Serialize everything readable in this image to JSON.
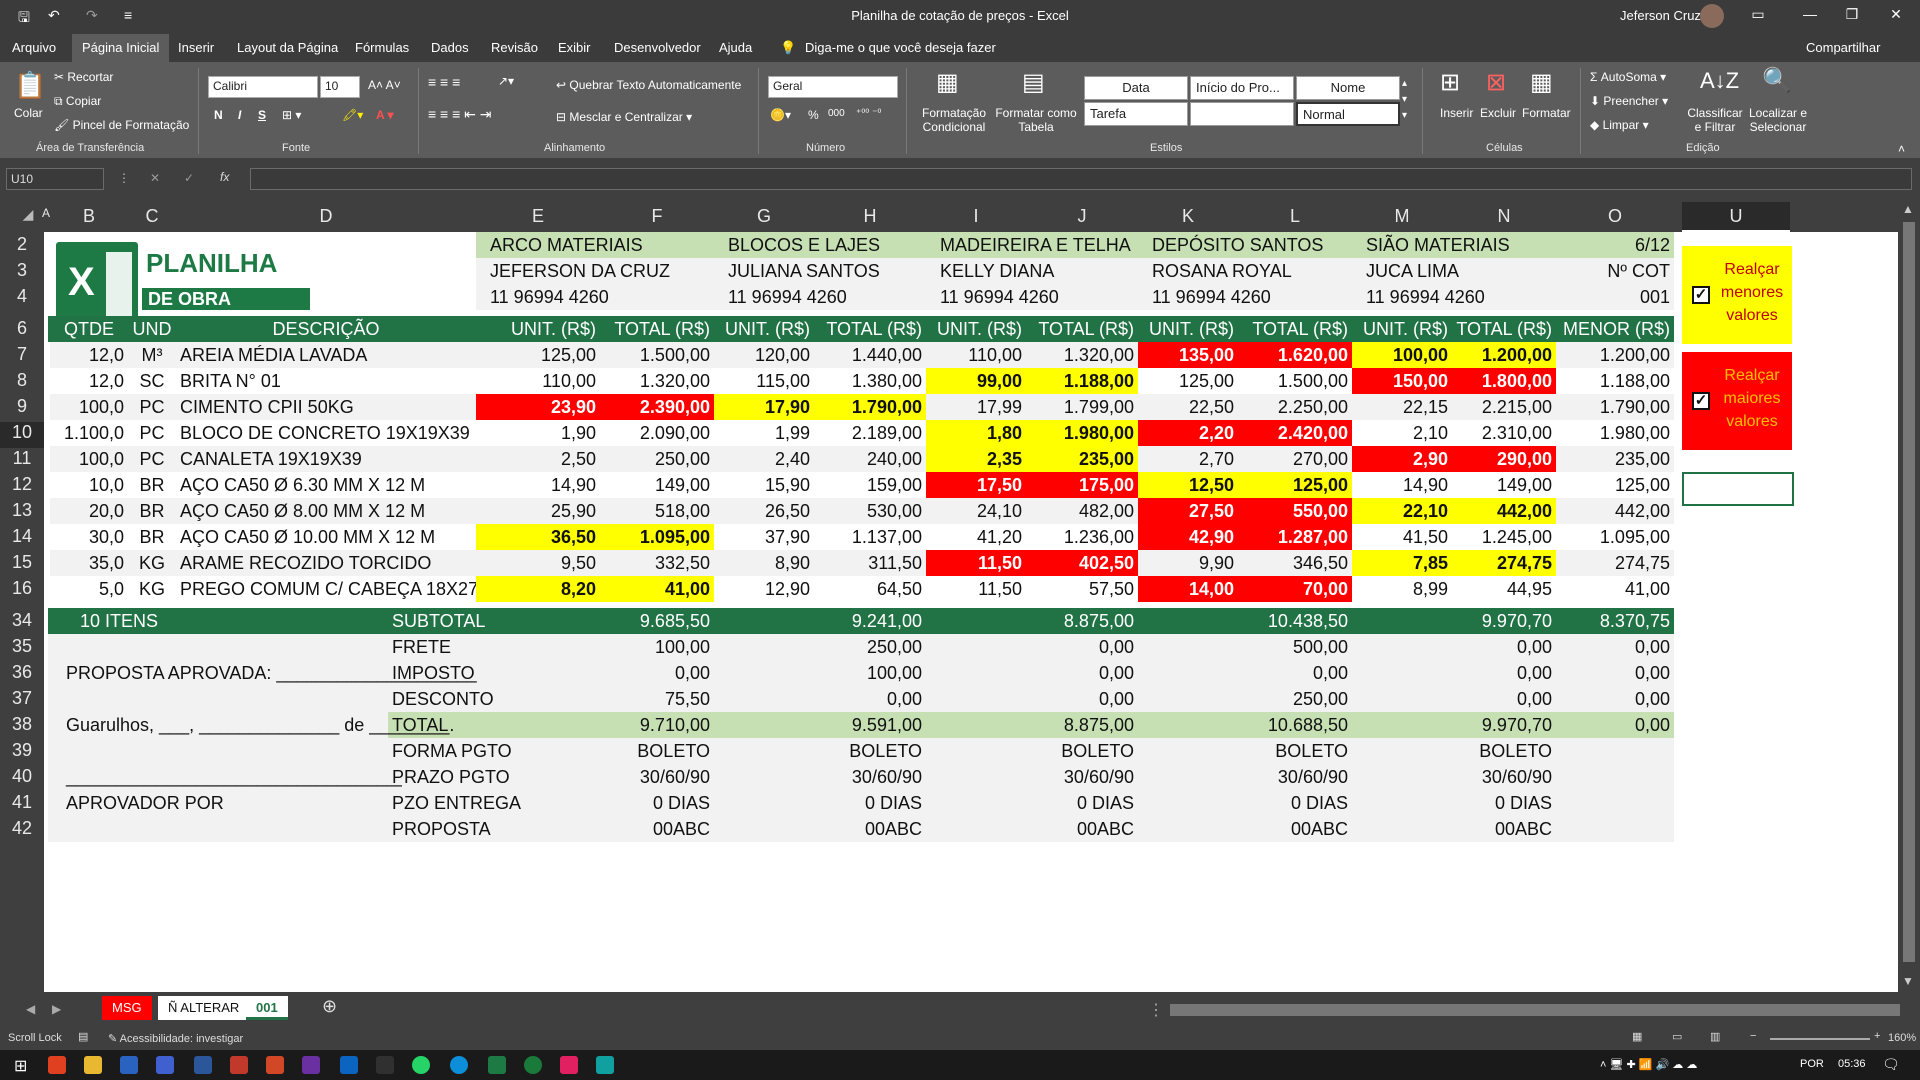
{
  "app": {
    "title": "Planilha de cotação de preços - Excel",
    "user": "Jeferson Cruz"
  },
  "tabs": [
    "Arquivo",
    "Página Inicial",
    "Inserir",
    "Layout da Página",
    "Fórmulas",
    "Dados",
    "Revisão",
    "Exibir",
    "Desenvolvedor",
    "Ajuda",
    "Diga-me o que você deseja fazer",
    "Compartilhar"
  ],
  "ribbon": {
    "clipboard": {
      "paste": "Colar",
      "cut": "Recortar",
      "copy": "Copiar",
      "painter": "Pincel de Formatação",
      "group": "Área de Transferência"
    },
    "font": {
      "name": "Calibri",
      "size": "10",
      "group": "Fonte",
      "bold": "N",
      "italic": "I",
      "underline": "S"
    },
    "alignment": {
      "wrap": "Quebrar Texto Automaticamente",
      "merge": "Mesclar e Centralizar",
      "group": "Alinhamento"
    },
    "number": {
      "format": "Geral",
      "group": "Número",
      "percent": "%",
      "thousands": "000"
    },
    "styles": {
      "conditional": "Formatação Condicional",
      "astable": "Formatar como Tabela",
      "group": "Estilos",
      "cells": [
        "Data",
        "Início do Pro...",
        "Nome",
        "Tarefa",
        "",
        "Normal"
      ]
    },
    "cells": {
      "insert": "Inserir",
      "delete": "Excluir",
      "format": "Formatar",
      "group": "Células"
    },
    "editing": {
      "autosum": "AutoSoma",
      "fill": "Preencher",
      "clear": "Limpar",
      "sort": "Classificar e Filtrar",
      "find": "Localizar e Selecionar",
      "group": "Edição"
    }
  },
  "formula_bar": {
    "name_box": "U10",
    "formula": "",
    "fx": "fx"
  },
  "columns": [
    "A",
    "B",
    "C",
    "D",
    "E",
    "F",
    "G",
    "H",
    "I",
    "J",
    "K",
    "L",
    "M",
    "N",
    "O",
    "",
    "U"
  ],
  "rows": [
    "2",
    "3",
    "4",
    "6",
    "7",
    "8",
    "9",
    "10",
    "11",
    "12",
    "13",
    "14",
    "15",
    "16",
    "34",
    "35",
    "36",
    "37",
    "38",
    "39",
    "40",
    "41",
    "42"
  ],
  "logo": {
    "line1": "PLANILHA",
    "line2": "DE OBRA",
    "letter": "X"
  },
  "suppliers": [
    {
      "name": "ARCO MATERIAIS",
      "contact": "JEFERSON DA CRUZ",
      "phone": "11 96994 4260"
    },
    {
      "name": "BLOCOS E LAJES",
      "contact": "JULIANA SANTOS",
      "phone": "11 96994 4260"
    },
    {
      "name": "MADEIREIRA E TELHA",
      "contact": "KELLY DIANA",
      "phone": "11 96994 4260"
    },
    {
      "name": "DEPÓSITO SANTOS",
      "contact": "ROSANA ROYAL",
      "phone": "11 96994 4260"
    },
    {
      "name": "SIÃO MATERIAIS",
      "contact": "JUCA LIMA",
      "phone": "11 96994 4260"
    }
  ],
  "cot": {
    "date": "6/12",
    "label": "Nº COT",
    "number": "001"
  },
  "table_header": {
    "qtde": "QTDE",
    "und": "UND",
    "desc": "DESCRIÇÃO",
    "unit": "UNIT. (R$)",
    "total": "TOTAL (R$)",
    "menor": "MENOR (R$)"
  },
  "items": [
    {
      "qtde": "12,0",
      "und": "M³",
      "desc": "AREIA MÉDIA LAVADA",
      "v": [
        [
          "125,00",
          "1.500,00"
        ],
        [
          "120,00",
          "1.440,00"
        ],
        [
          "110,00",
          "1.320,00"
        ],
        [
          "135,00",
          "1.620,00"
        ],
        [
          "100,00",
          "1.200,00"
        ]
      ],
      "hl": [
        "",
        "",
        "",
        "red",
        "yel"
      ],
      "menor": "1.200,00"
    },
    {
      "qtde": "12,0",
      "und": "SC",
      "desc": "BRITA N° 01",
      "v": [
        [
          "110,00",
          "1.320,00"
        ],
        [
          "115,00",
          "1.380,00"
        ],
        [
          "99,00",
          "1.188,00"
        ],
        [
          "125,00",
          "1.500,00"
        ],
        [
          "150,00",
          "1.800,00"
        ]
      ],
      "hl": [
        "",
        "",
        "yel",
        "",
        "red"
      ],
      "menor": "1.188,00"
    },
    {
      "qtde": "100,0",
      "und": "PC",
      "desc": "CIMENTO CPII 50KG",
      "v": [
        [
          "23,90",
          "2.390,00"
        ],
        [
          "17,90",
          "1.790,00"
        ],
        [
          "17,99",
          "1.799,00"
        ],
        [
          "22,50",
          "2.250,00"
        ],
        [
          "22,15",
          "2.215,00"
        ]
      ],
      "hl": [
        "red",
        "yel",
        "",
        "",
        ""
      ],
      "menor": "1.790,00"
    },
    {
      "qtde": "1.100,0",
      "und": "PC",
      "desc": "BLOCO DE CONCRETO 19X19X39",
      "v": [
        [
          "1,90",
          "2.090,00"
        ],
        [
          "1,99",
          "2.189,00"
        ],
        [
          "1,80",
          "1.980,00"
        ],
        [
          "2,20",
          "2.420,00"
        ],
        [
          "2,10",
          "2.310,00"
        ]
      ],
      "hl": [
        "",
        "",
        "yel",
        "red",
        ""
      ],
      "menor": "1.980,00"
    },
    {
      "qtde": "100,0",
      "und": "PC",
      "desc": "CANALETA 19X19X39",
      "v": [
        [
          "2,50",
          "250,00"
        ],
        [
          "2,40",
          "240,00"
        ],
        [
          "2,35",
          "235,00"
        ],
        [
          "2,70",
          "270,00"
        ],
        [
          "2,90",
          "290,00"
        ]
      ],
      "hl": [
        "",
        "",
        "yel",
        "",
        "red"
      ],
      "menor": "235,00"
    },
    {
      "qtde": "10,0",
      "und": "BR",
      "desc": "AÇO CA50 Ø 6.30 MM X 12 M",
      "v": [
        [
          "14,90",
          "149,00"
        ],
        [
          "15,90",
          "159,00"
        ],
        [
          "17,50",
          "175,00"
        ],
        [
          "12,50",
          "125,00"
        ],
        [
          "14,90",
          "149,00"
        ]
      ],
      "hl": [
        "",
        "",
        "red",
        "yel",
        ""
      ],
      "menor": "125,00"
    },
    {
      "qtde": "20,0",
      "und": "BR",
      "desc": "AÇO CA50 Ø 8.00 MM X 12 M",
      "v": [
        [
          "25,90",
          "518,00"
        ],
        [
          "26,50",
          "530,00"
        ],
        [
          "24,10",
          "482,00"
        ],
        [
          "27,50",
          "550,00"
        ],
        [
          "22,10",
          "442,00"
        ]
      ],
      "hl": [
        "",
        "",
        "",
        "red",
        "yel"
      ],
      "menor": "442,00"
    },
    {
      "qtde": "30,0",
      "und": "BR",
      "desc": "AÇO CA50 Ø 10.00 MM X 12 M",
      "v": [
        [
          "36,50",
          "1.095,00"
        ],
        [
          "37,90",
          "1.137,00"
        ],
        [
          "41,20",
          "1.236,00"
        ],
        [
          "42,90",
          "1.287,00"
        ],
        [
          "41,50",
          "1.245,00"
        ]
      ],
      "hl": [
        "yel",
        "",
        "",
        "red",
        ""
      ],
      "menor": "1.095,00"
    },
    {
      "qtde": "35,0",
      "und": "KG",
      "desc": "ARAME RECOZIDO TORCIDO",
      "v": [
        [
          "9,50",
          "332,50"
        ],
        [
          "8,90",
          "311,50"
        ],
        [
          "11,50",
          "402,50"
        ],
        [
          "9,90",
          "346,50"
        ],
        [
          "7,85",
          "274,75"
        ]
      ],
      "hl": [
        "",
        "",
        "red",
        "",
        "yel"
      ],
      "menor": "274,75"
    },
    {
      "qtde": "5,0",
      "und": "KG",
      "desc": "PREGO COMUM C/ CABEÇA 18X27",
      "v": [
        [
          "8,20",
          "41,00"
        ],
        [
          "12,90",
          "64,50"
        ],
        [
          "11,50",
          "57,50"
        ],
        [
          "14,00",
          "70,00"
        ],
        [
          "8,99",
          "44,95"
        ]
      ],
      "hl": [
        "yel",
        "",
        "",
        "red",
        ""
      ],
      "menor": "41,00"
    }
  ],
  "summary": {
    "items_count": "10 ITENS",
    "rows": [
      {
        "label": "SUBTOTAL",
        "v": [
          "9.685,50",
          "9.241,00",
          "8.875,00",
          "10.438,50",
          "9.970,70",
          "8.370,75"
        ]
      },
      {
        "label": "FRETE",
        "v": [
          "100,00",
          "250,00",
          "0,00",
          "500,00",
          "0,00",
          "0,00"
        ]
      },
      {
        "label": "IMPOSTO",
        "v": [
          "0,00",
          "100,00",
          "0,00",
          "0,00",
          "0,00",
          "0,00"
        ]
      },
      {
        "label": "DESCONTO",
        "v": [
          "75,50",
          "0,00",
          "0,00",
          "250,00",
          "0,00",
          "0,00"
        ]
      },
      {
        "label": "TOTAL",
        "v": [
          "9.710,00",
          "9.591,00",
          "8.875,00",
          "10.688,50",
          "9.970,70",
          "0,00"
        ]
      },
      {
        "label": "FORMA PGTO",
        "v": [
          "BOLETO",
          "BOLETO",
          "BOLETO",
          "BOLETO",
          "BOLETO",
          ""
        ]
      },
      {
        "label": "PRAZO PGTO",
        "v": [
          "30/60/90",
          "30/60/90",
          "30/60/90",
          "30/60/90",
          "30/60/90",
          ""
        ]
      },
      {
        "label": "PZO ENTREGA",
        "v": [
          "0 DIAS",
          "0 DIAS",
          "0 DIAS",
          "0 DIAS",
          "0 DIAS",
          ""
        ]
      },
      {
        "label": "PROPOSTA",
        "v": [
          "00ABC",
          "00ABC",
          "00ABC",
          "00ABC",
          "00ABC",
          ""
        ]
      }
    ],
    "approved": "PROPOSTA APROVADA: ____________________",
    "place": "Guarulhos, ___, ______________ de ________.",
    "sig_line": "__________________________________",
    "approver": "APROVADOR POR"
  },
  "highlight_buttons": {
    "lower": "Realçar menores valores",
    "higher": "Realçar maiores valores",
    "lower_color": "#ffff00",
    "higher_color": "#ff0000"
  },
  "sheet_tabs": [
    "MSG",
    "Ñ ALTERAR",
    "001"
  ],
  "status": {
    "scroll_lock": "Scroll Lock",
    "accessibility": "Acessibilidade: investigar",
    "zoom": "160%"
  },
  "taskbar": {
    "lang": "POR",
    "time": "05:36"
  }
}
